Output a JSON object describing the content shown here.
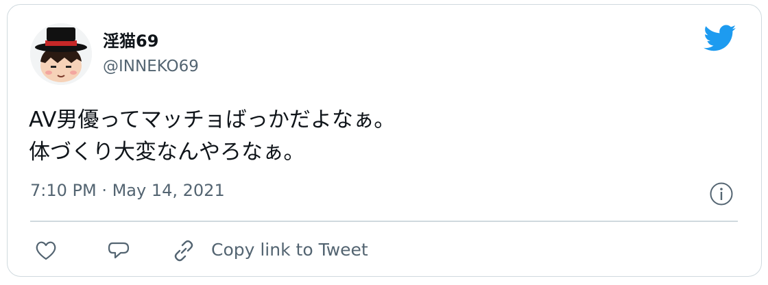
{
  "tweet": {
    "display_name": "淫猫69",
    "handle": "@INNEKO69",
    "text": "AV男優ってマッチョばっかだよなぁ。\n体づくり大変なんやろなぁ。",
    "timestamp": "7:10 PM · May 14, 2021"
  },
  "actions": {
    "copy_link_label": "Copy link to Tweet"
  },
  "colors": {
    "brand_blue": "#1d9bf0",
    "text_primary": "#0f1419",
    "text_secondary": "#536471",
    "border": "#cfd9de"
  },
  "icons": {
    "logo": "twitter-bird-icon",
    "info": "info-icon",
    "like": "heart-icon",
    "reply": "speech-bubble-icon",
    "copy_link": "link-icon"
  }
}
